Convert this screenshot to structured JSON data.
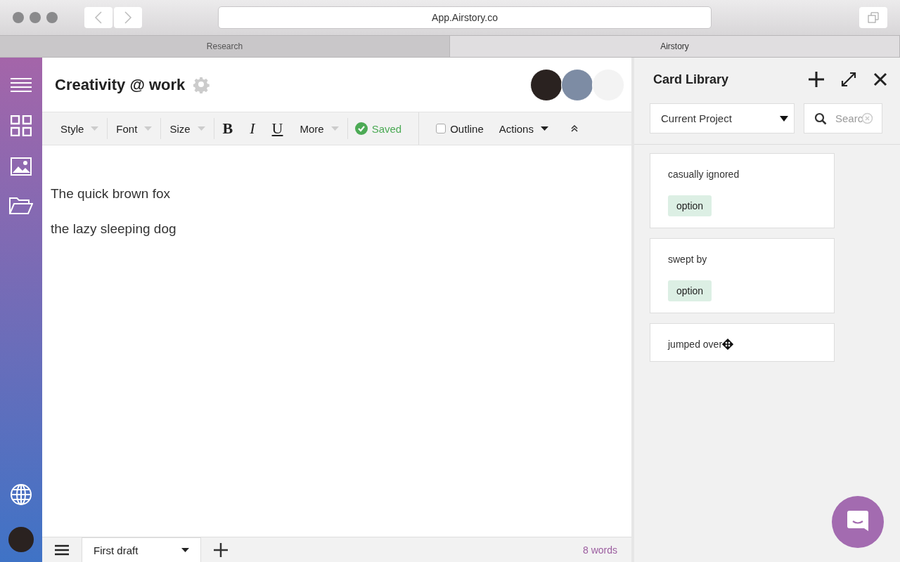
{
  "browser": {
    "address": "App.Airstory.co",
    "tabs": [
      {
        "label": "Research",
        "selected": false
      },
      {
        "label": "Airstory",
        "selected": true
      }
    ]
  },
  "document": {
    "title": "Creativity @ work",
    "toolbar": [
      {
        "kind": "dropdown",
        "label": "Style"
      },
      {
        "kind": "dropdown",
        "label": "Font"
      },
      {
        "kind": "dropdown",
        "label": "Size"
      },
      {
        "kind": "bold",
        "label": "B"
      },
      {
        "kind": "italic",
        "label": "I"
      },
      {
        "kind": "underline",
        "label": "U"
      },
      {
        "kind": "dropdown",
        "label": "More"
      },
      {
        "kind": "status",
        "label": "Saved"
      }
    ],
    "outline": {
      "label": "Outline",
      "checked": false
    },
    "actions": "Actions",
    "paragraphs": [
      "The quick brown fox",
      "the lazy sleeping dog"
    ],
    "footer": {
      "draft": "First draft",
      "word_count": "8 words"
    }
  },
  "card_library": {
    "title": "Card Library",
    "filter": "Current Project",
    "search": {
      "placeholder": "Searc"
    },
    "cards": [
      {
        "text": "casually ignored",
        "tag": "option"
      },
      {
        "text": "swept by",
        "tag": "option"
      },
      {
        "text": "jumped over"
      }
    ]
  }
}
